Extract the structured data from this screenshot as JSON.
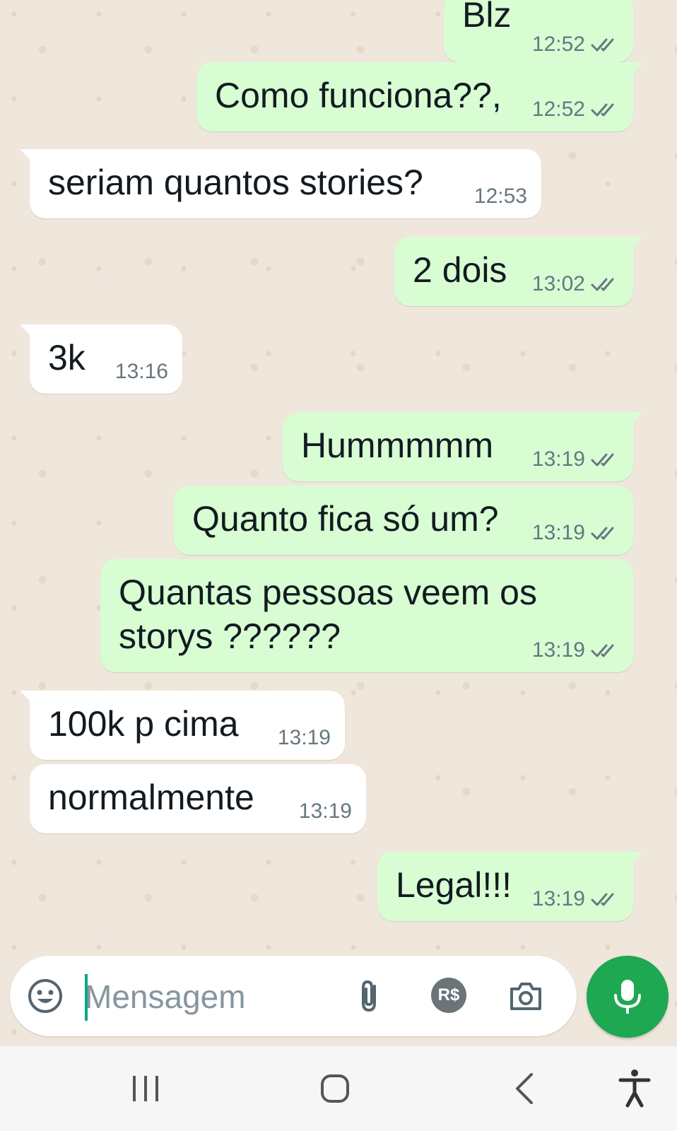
{
  "messages": [
    {
      "text": "Blz",
      "time": "12:52",
      "dir": "out",
      "read": true
    },
    {
      "text": "Como funciona??,",
      "time": "12:52",
      "dir": "out",
      "read": true
    },
    {
      "text": "seriam quantos stories?",
      "time": "12:53",
      "dir": "in"
    },
    {
      "text": "2 dois",
      "time": "13:02",
      "dir": "out",
      "read": true
    },
    {
      "text": "3k",
      "time": "13:16",
      "dir": "in"
    },
    {
      "text": "Hummmmm",
      "time": "13:19",
      "dir": "out",
      "read": true
    },
    {
      "text": "Quanto fica só um?",
      "time": "13:19",
      "dir": "out",
      "read": true
    },
    {
      "text": "Quantas pessoas veem os\nstorys ??????",
      "time": "13:19",
      "dir": "out",
      "read": true
    },
    {
      "text": "100k p cima",
      "time": "13:19",
      "dir": "in"
    },
    {
      "text": "normalmente",
      "time": "13:19",
      "dir": "in"
    },
    {
      "text": "Legal!!!",
      "time": "13:19",
      "dir": "out",
      "read": true
    }
  ],
  "composer": {
    "placeholder": "Mensagem",
    "value": "",
    "icons": [
      "emoji-icon",
      "attach-icon",
      "payment-icon",
      "camera-icon"
    ],
    "payment_label": "R$"
  },
  "mic_icon": "microphone-icon",
  "navigation": [
    "recent-apps-icon",
    "home-icon",
    "back-icon",
    "accessibility-icon"
  ],
  "colors": {
    "outgoing_bubble": "#d9fdd3",
    "incoming_bubble": "#ffffff",
    "accent": "#1da851",
    "read_ticks": "#667781"
  }
}
